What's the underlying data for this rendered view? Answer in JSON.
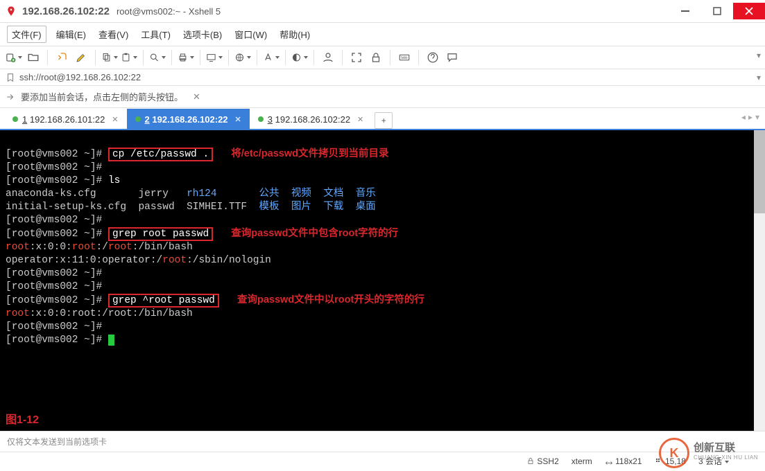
{
  "title": {
    "ip": "192.168.26.102:22",
    "sub": "root@vms002:~ - Xshell 5"
  },
  "menu": {
    "file": "文件(F)",
    "edit": "编辑(E)",
    "view": "查看(V)",
    "tools": "工具(T)",
    "tabs": "选项卡(B)",
    "window": "窗口(W)",
    "help": "帮助(H)"
  },
  "addr": {
    "url": "ssh://root@192.168.26.102:22"
  },
  "info": {
    "msg": "要添加当前会话，点击左侧的箭头按钮。"
  },
  "tabs": {
    "t1": {
      "num": "1",
      "label": "192.168.26.101:22"
    },
    "t2": {
      "num": "2",
      "label": "192.168.26.102:22"
    },
    "t3": {
      "num": "3",
      "label": "192.168.26.102:22"
    }
  },
  "term": {
    "prompt": "[root@vms002 ~]#",
    "cmd_cp": "cp /etc/passwd .",
    "ann_cp": "将/etc/passwd文件拷贝到当前目录",
    "cmd_ls": "ls",
    "ls_row1": {
      "c1": "anaconda-ks.cfg",
      "c2": "jerry",
      "c3": "rh124",
      "c4": "公共",
      "c5": "视频",
      "c6": "文档",
      "c7": "音乐"
    },
    "ls_row2": {
      "c1": "initial-setup-ks.cfg",
      "c2": "passwd",
      "c3": "SIMHEI.TTF",
      "c4": "模板",
      "c5": "图片",
      "c6": "下载",
      "c7": "桌面"
    },
    "cmd_grep1": "grep root passwd",
    "ann_grep1": "查询passwd文件中包含root字符的行",
    "out1a_1": "root",
    "out1a_2": ":x:0:0:",
    "out1a_3": "root",
    "out1a_4": ":/",
    "out1a_5": "root",
    "out1a_6": ":/bin/bash",
    "out1b_1": "operator:x:11:0:operator:/",
    "out1b_2": "root",
    "out1b_3": ":/sbin/nologin",
    "cmd_grep2": "grep ^root passwd",
    "ann_grep2": "查询passwd文件中以root开头的字符的行",
    "out2_1": "root",
    "out2_2": ":x:0:0:root:/root:/bin/bash",
    "figure": "图1-12"
  },
  "send": {
    "placeholder": "仅将文本发送到当前选项卡"
  },
  "status": {
    "proto": "SSH2",
    "term": "xterm",
    "size": "118x21",
    "pos": "15,18",
    "sess": "3 会话"
  },
  "watermark": {
    "cn": "创新互联",
    "en": "CHUANG XIN HU LIAN"
  }
}
